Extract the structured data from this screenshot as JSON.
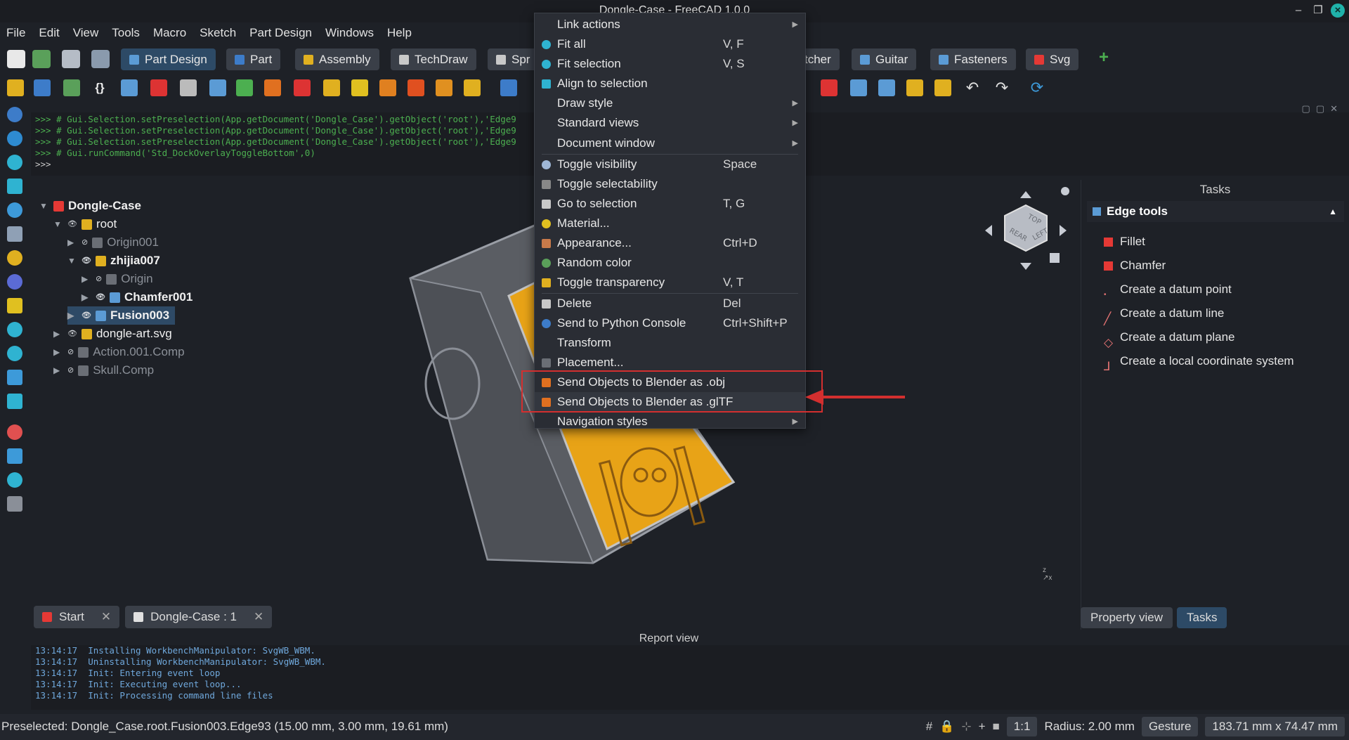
{
  "window": {
    "title": "Dongle-Case - FreeCAD 1.0.0"
  },
  "menubar": [
    "File",
    "Edit",
    "View",
    "Tools",
    "Macro",
    "Sketch",
    "Part Design",
    "Windows",
    "Help"
  ],
  "workbenches": [
    {
      "label": "Part Design",
      "active": true
    },
    {
      "label": "Part"
    },
    {
      "label": "Assembly"
    },
    {
      "label": "TechDraw"
    },
    {
      "label": "Spr"
    },
    {
      "label": "tcher"
    },
    {
      "label": "Guitar"
    },
    {
      "label": "Fasteners"
    },
    {
      "label": "Svg"
    }
  ],
  "python_console": [
    ">>> # Gui.Selection.setPreselection(App.getDocument('Dongle_Case').getObject('root'),'Edge9",
    ">>> # Gui.Selection.setPreselection(App.getDocument('Dongle_Case').getObject('root'),'Edge9",
    ">>> # Gui.Selection.setPreselection(App.getDocument('Dongle_Case').getObject('root'),'Edge9",
    ">>> # Gui.runCommand('Std_DockOverlayToggleBottom',0)",
    ">>>"
  ],
  "tree": [
    {
      "label": "Dongle-Case"
    },
    {
      "label": "root"
    },
    {
      "label": "Origin001"
    },
    {
      "label": "zhijia007"
    },
    {
      "label": "Origin"
    },
    {
      "label": "Chamfer001"
    },
    {
      "label": "Fusion003"
    },
    {
      "label": "dongle-art.svg"
    },
    {
      "label": "Action.001.Comp"
    },
    {
      "label": "Skull.Comp"
    }
  ],
  "context_menu": {
    "items": [
      {
        "label": "Link actions",
        "shortcut": "",
        "submenu": true
      },
      {
        "label": "Fit all",
        "shortcut": "V, F"
      },
      {
        "label": "Fit selection",
        "shortcut": "V, S"
      },
      {
        "label": "Align to selection",
        "shortcut": ""
      },
      {
        "label": "Draw style",
        "shortcut": "",
        "submenu": true
      },
      {
        "label": "Standard views",
        "shortcut": "",
        "submenu": true
      },
      {
        "label": "Document window",
        "shortcut": "",
        "submenu": true
      },
      {
        "label": "Toggle visibility",
        "shortcut": "Space"
      },
      {
        "label": "Toggle selectability",
        "shortcut": ""
      },
      {
        "label": "Go to selection",
        "shortcut": "T, G"
      },
      {
        "label": "Material...",
        "shortcut": ""
      },
      {
        "label": "Appearance...",
        "shortcut": "Ctrl+D"
      },
      {
        "label": "Random color",
        "shortcut": ""
      },
      {
        "label": "Toggle transparency",
        "shortcut": "V, T"
      },
      {
        "label": "Delete",
        "shortcut": "Del"
      },
      {
        "label": "Send to Python Console",
        "shortcut": "Ctrl+Shift+P"
      },
      {
        "label": "Transform",
        "shortcut": ""
      },
      {
        "label": "Placement...",
        "shortcut": ""
      },
      {
        "label": "Send Objects to Blender as .obj",
        "shortcut": ""
      },
      {
        "label": "Send Objects to Blender as .glTF",
        "shortcut": ""
      },
      {
        "label": "Navigation styles",
        "shortcut": "",
        "submenu": true
      }
    ]
  },
  "tasks": {
    "title": "Tasks",
    "section": "Edge tools",
    "items": [
      "Fillet",
      "Chamfer",
      "Create a datum point",
      "Create a datum line",
      "Create a datum plane",
      "Create a local coordinate system"
    ]
  },
  "panel_tabs": [
    "Property view",
    "Tasks"
  ],
  "doc_tabs": [
    "Start",
    "Dongle-Case : 1"
  ],
  "report": {
    "title": "Report view",
    "lines": [
      "13:14:17  Installing WorkbenchManipulator: SvgWB_WBM.",
      "13:14:17  Uninstalling WorkbenchManipulator: SvgWB_WBM.",
      "13:14:17  Init: Entering event loop",
      "13:14:17  Init: Executing event loop...",
      "13:14:17  Init: Processing command line files"
    ]
  },
  "statusbar": {
    "text": "Preselected: Dongle_Case.root.Fusion003.Edge93 (15.00 mm, 3.00 mm, 19.61 mm)",
    "ratio": "1:1",
    "radius": "Radius: 2.00 mm",
    "nav": "Gesture",
    "dims": "183.71 mm x 74.47 mm"
  },
  "navcube": {
    "top": "TOP",
    "left": "LEFT",
    "rear": "REAR"
  },
  "colors": {
    "accent": "#2d4a66",
    "highlight": "#d32f2f",
    "model": "#e8a317"
  }
}
